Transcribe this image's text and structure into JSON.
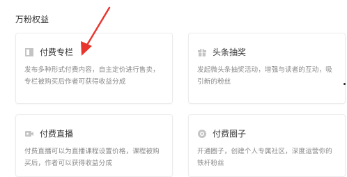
{
  "section": {
    "title": "万粉权益"
  },
  "cards": [
    {
      "title": "付费专栏",
      "icon": "column-icon",
      "desc": "发布多种形式付费内容，自主定价进行售卖，专栏被购买后作者可获得收益分成"
    },
    {
      "title": "头条抽奖",
      "icon": "lottery-icon",
      "desc": "发起微头条抽奖活动，增强与读者的互动，吸引新的粉丝"
    },
    {
      "title": "付费直播",
      "icon": "live-video-icon",
      "desc": "付费直播可以为直播课程设置价格，课程被购买后，作者可以获得收益分成"
    },
    {
      "title": "付费圈子",
      "icon": "circle-icon",
      "desc": "开通圈子，创建个人专属社区，深度运营你的铁杆粉丝"
    }
  ],
  "colors": {
    "annotation_arrow": "#e8352d",
    "icon_gray": "#c4c4c4"
  }
}
